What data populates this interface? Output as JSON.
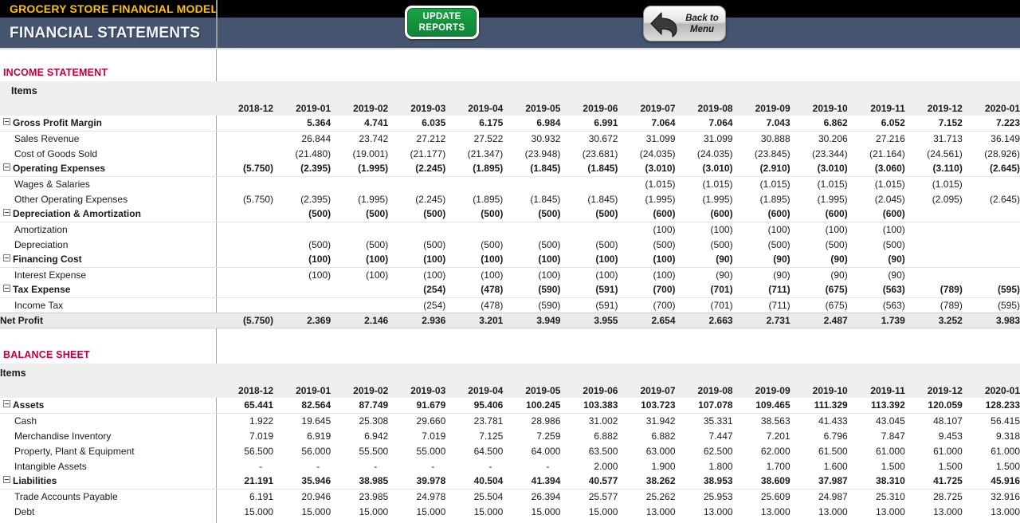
{
  "banner": {
    "model_title": "GROCERY STORE FINANCIAL MODEL",
    "page_title": "FINANCIAL STATEMENTS",
    "update_button_line1": "UPDATE",
    "update_button_line2": "REPORTS",
    "back_button_line1": "Back to",
    "back_button_line2": "Menu",
    "accent_gold": "#ffc000",
    "slate": "#455570",
    "green": "#17a343",
    "section_red": "#c00040"
  },
  "periods": [
    "2018-12",
    "2019-01",
    "2019-02",
    "2019-03",
    "2019-04",
    "2019-05",
    "2019-06",
    "2019-07",
    "2019-08",
    "2019-09",
    "2019-10",
    "2019-11",
    "2019-12",
    "2020-01"
  ],
  "income_statement": {
    "section_title": "INCOME STATEMENT",
    "items_header": "Items",
    "rows": [
      {
        "label": "Gross Profit Margin",
        "type": "group",
        "values": [
          "",
          "5.364",
          "4.741",
          "6.035",
          "6.175",
          "6.984",
          "6.991",
          "7.064",
          "7.064",
          "7.043",
          "6.862",
          "6.052",
          "7.152",
          "7.223"
        ]
      },
      {
        "label": "Sales Revenue",
        "type": "child",
        "values": [
          "",
          "26.844",
          "23.742",
          "27.212",
          "27.522",
          "30.932",
          "30.672",
          "31.099",
          "31.099",
          "30.888",
          "30.206",
          "27.216",
          "31.713",
          "36.149"
        ]
      },
      {
        "label": "Cost of Goods Sold",
        "type": "child",
        "values": [
          "",
          "(21.480)",
          "(19.001)",
          "(21.177)",
          "(21.347)",
          "(23.948)",
          "(23.681)",
          "(24.035)",
          "(24.035)",
          "(23.845)",
          "(23.344)",
          "(21.164)",
          "(24.561)",
          "(28.926)"
        ]
      },
      {
        "label": "Operating Expenses",
        "type": "group",
        "values": [
          "(5.750)",
          "(2.395)",
          "(1.995)",
          "(2.245)",
          "(1.895)",
          "(1.845)",
          "(1.845)",
          "(3.010)",
          "(3.010)",
          "(2.910)",
          "(3.010)",
          "(3.060)",
          "(3.110)",
          "(2.645)"
        ]
      },
      {
        "label": "Wages & Salaries",
        "type": "child",
        "values": [
          "",
          "",
          "",
          "",
          "",
          "",
          "",
          "(1.015)",
          "(1.015)",
          "(1.015)",
          "(1.015)",
          "(1.015)",
          "(1.015)",
          ""
        ]
      },
      {
        "label": "Other Operating Expenses",
        "type": "child",
        "values": [
          "(5.750)",
          "(2.395)",
          "(1.995)",
          "(2.245)",
          "(1.895)",
          "(1.845)",
          "(1.845)",
          "(1.995)",
          "(1.995)",
          "(1.895)",
          "(1.995)",
          "(2.045)",
          "(2.095)",
          "(2.645)"
        ]
      },
      {
        "label": "Depreciation & Amortization",
        "type": "group",
        "values": [
          "",
          "(500)",
          "(500)",
          "(500)",
          "(500)",
          "(500)",
          "(500)",
          "(600)",
          "(600)",
          "(600)",
          "(600)",
          "(600)",
          "",
          ""
        ]
      },
      {
        "label": "Amortization",
        "type": "child",
        "values": [
          "",
          "",
          "",
          "",
          "",
          "",
          "",
          "(100)",
          "(100)",
          "(100)",
          "(100)",
          "(100)",
          "",
          ""
        ]
      },
      {
        "label": "Depreciation",
        "type": "child",
        "values": [
          "",
          "(500)",
          "(500)",
          "(500)",
          "(500)",
          "(500)",
          "(500)",
          "(500)",
          "(500)",
          "(500)",
          "(500)",
          "(500)",
          "",
          ""
        ]
      },
      {
        "label": "Financing Cost",
        "type": "group",
        "values": [
          "",
          "(100)",
          "(100)",
          "(100)",
          "(100)",
          "(100)",
          "(100)",
          "(100)",
          "(90)",
          "(90)",
          "(90)",
          "(90)",
          "",
          ""
        ]
      },
      {
        "label": "Interest Expense",
        "type": "child",
        "values": [
          "",
          "(100)",
          "(100)",
          "(100)",
          "(100)",
          "(100)",
          "(100)",
          "(100)",
          "(90)",
          "(90)",
          "(90)",
          "(90)",
          "",
          ""
        ]
      },
      {
        "label": "Tax Expense",
        "type": "group",
        "values": [
          "",
          "",
          "",
          "(254)",
          "(478)",
          "(590)",
          "(591)",
          "(700)",
          "(701)",
          "(711)",
          "(675)",
          "(563)",
          "(789)",
          "(595)"
        ]
      },
      {
        "label": "Income Tax",
        "type": "child",
        "values": [
          "",
          "",
          "",
          "(254)",
          "(478)",
          "(590)",
          "(591)",
          "(700)",
          "(701)",
          "(711)",
          "(675)",
          "(563)",
          "(789)",
          "(595)"
        ]
      },
      {
        "label": "Net Profit",
        "type": "total",
        "values": [
          "(5.750)",
          "2.369",
          "2.146",
          "2.936",
          "3.201",
          "3.949",
          "3.955",
          "2.654",
          "2.663",
          "2.731",
          "2.487",
          "1.739",
          "3.252",
          "3.983"
        ]
      }
    ]
  },
  "balance_sheet": {
    "section_title": "BALANCE SHEET",
    "items_header": "Items",
    "rows": [
      {
        "label": "Assets",
        "type": "group",
        "values": [
          "65.441",
          "82.564",
          "87.749",
          "91.679",
          "95.406",
          "100.245",
          "103.383",
          "103.723",
          "107.078",
          "109.465",
          "111.329",
          "113.392",
          "120.059",
          "128.233"
        ]
      },
      {
        "label": "Cash",
        "type": "child",
        "values": [
          "1.922",
          "19.645",
          "25.308",
          "29.660",
          "23.781",
          "28.986",
          "31.002",
          "31.942",
          "35.331",
          "38.563",
          "41.433",
          "43.045",
          "48.107",
          "56.415"
        ]
      },
      {
        "label": "Merchandise Inventory",
        "type": "child",
        "values": [
          "7.019",
          "6.919",
          "6.942",
          "7.019",
          "7.125",
          "7.259",
          "6.882",
          "6.882",
          "7.447",
          "7.201",
          "6.796",
          "7.847",
          "9.453",
          "9.318"
        ]
      },
      {
        "label": "Property, Plant & Equipment",
        "type": "child",
        "values": [
          "56.500",
          "56.000",
          "55.500",
          "55.000",
          "64.500",
          "64.000",
          "63.500",
          "63.000",
          "62.500",
          "62.000",
          "61.500",
          "61.000",
          "61.000",
          "61.000"
        ]
      },
      {
        "label": "Intangible Assets",
        "type": "child",
        "values": [
          "-",
          "-",
          "-",
          "-",
          "-",
          "-",
          "2.000",
          "1.900",
          "1.800",
          "1.700",
          "1.600",
          "1.500",
          "1.500",
          "1.500"
        ]
      },
      {
        "label": "Liabilities",
        "type": "group",
        "values": [
          "21.191",
          "35.946",
          "38.985",
          "39.978",
          "40.504",
          "41.394",
          "40.577",
          "38.262",
          "38.953",
          "38.609",
          "37.987",
          "38.310",
          "41.725",
          "45.916"
        ]
      },
      {
        "label": "Trade Accounts Payable",
        "type": "child",
        "values": [
          "6.191",
          "20.946",
          "23.985",
          "24.978",
          "25.504",
          "26.394",
          "25.577",
          "25.262",
          "25.953",
          "25.609",
          "24.987",
          "25.310",
          "28.725",
          "32.916"
        ]
      },
      {
        "label": "Debt",
        "type": "child",
        "values": [
          "15.000",
          "15.000",
          "15.000",
          "15.000",
          "15.000",
          "15.000",
          "15.000",
          "13.000",
          "13.000",
          "13.000",
          "13.000",
          "13.000",
          "13.000",
          "13.000"
        ]
      }
    ]
  }
}
